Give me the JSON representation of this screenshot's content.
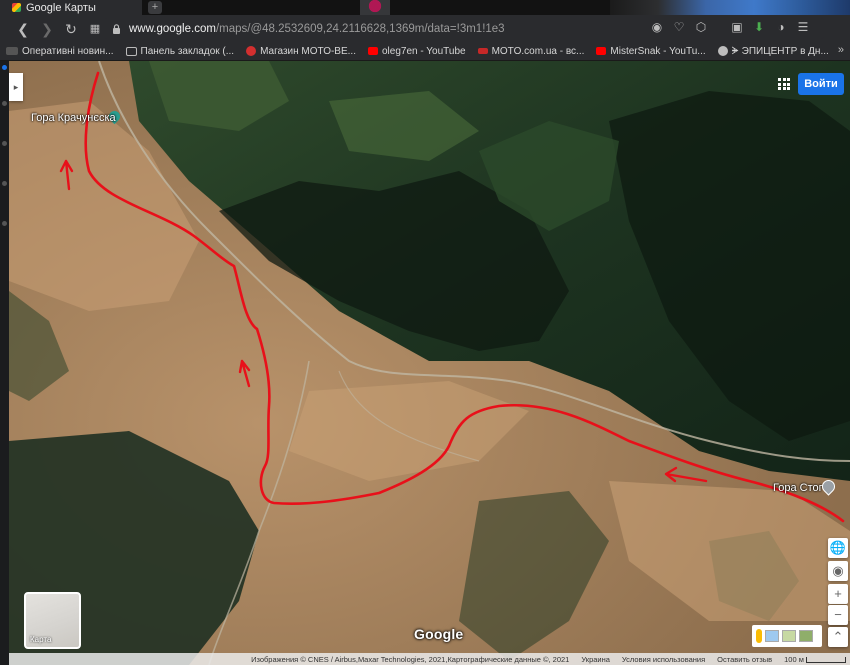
{
  "browser": {
    "tab_title": "Google Карты",
    "new_tab_glyph": "+",
    "url_host": "www.google.com",
    "url_path": "/maps/@48.2532609,24.2116628,1369m/data=!3m1!1e3",
    "icons": {
      "back": "back-arrow-icon",
      "forward": "forward-arrow-icon",
      "reload": "reload-icon",
      "grid": "speed-dial-icon"
    }
  },
  "bookmarks": [
    {
      "label": "Оперативні новин...",
      "icon": "news-icon",
      "color": "#555555"
    },
    {
      "label": "Панель закладок (...",
      "icon": "folder-icon",
      "color": "#9e9e9e"
    },
    {
      "label": "Магазин МОТО-ВЕ...",
      "icon": "moto-shop-icon",
      "color": "#d32f2f"
    },
    {
      "label": "oleg7en - YouTube",
      "icon": "youtube-icon",
      "color": "#ff0000"
    },
    {
      "label": "MOTO.com.ua - вс...",
      "icon": "moto-site-icon",
      "color": "#c62828"
    },
    {
      "label": "MisterSnak - YouTu...",
      "icon": "youtube-icon",
      "color": "#ff0000"
    },
    {
      "label": "ᗙ ЭПИЦЕНТР в Дн...",
      "icon": "epicentr-icon",
      "color": "#bdbdbd"
    }
  ],
  "map": {
    "sign_in": "Войти",
    "place_left": "Гора Крачунєска",
    "place_right": "Гора Стог",
    "thumbnail_label": "Карта",
    "logo": "Google",
    "route_color": "#e8101a",
    "attribution": {
      "imagery": "Изображения © CNES / Airbus,Maxar Technologies, 2021,Картографические данные ©, 2021",
      "country": "Украина",
      "terms": "Условия использования",
      "feedback": "Оставить отзыв",
      "scale": "100 м"
    },
    "controls": {
      "globe": "globe-icon",
      "location": "my-location-icon",
      "zoom_in": "+",
      "zoom_out": "−",
      "expand": "chevron-up-icon"
    }
  }
}
